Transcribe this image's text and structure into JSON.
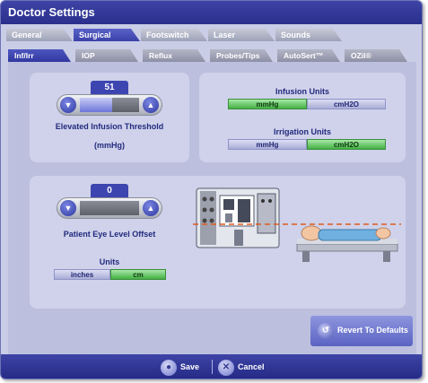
{
  "window": {
    "title": "Doctor Settings"
  },
  "main_tabs": [
    {
      "label": "General",
      "active": false
    },
    {
      "label": "Surgical",
      "active": true
    },
    {
      "label": "Footswitch",
      "active": false
    },
    {
      "label": "Laser",
      "active": false
    },
    {
      "label": "Sounds",
      "active": false
    }
  ],
  "sub_tabs": [
    {
      "label": "Inf/Irr",
      "active": true
    },
    {
      "label": "IOP",
      "active": false
    },
    {
      "label": "Reflux",
      "active": false
    },
    {
      "label": "Probes/Tips",
      "active": false
    },
    {
      "label": "AutoSert™",
      "active": false
    },
    {
      "label": "OZil®",
      "active": false
    }
  ],
  "infusion_threshold": {
    "value": "51",
    "label": "Elevated Infusion Threshold",
    "unit": "(mmHg)",
    "level_fraction": 0.55,
    "decrease_icon": "arrow-down-icon",
    "increase_icon": "arrow-up-icon"
  },
  "infusion_units": {
    "title": "Infusion Units",
    "options": [
      "mmHg",
      "cmH2O"
    ],
    "selected": "mmHg"
  },
  "irrigation_units": {
    "title": "Irrigation Units",
    "options": [
      "mmHg",
      "cmH2O"
    ],
    "selected": "cmH2O"
  },
  "eye_level": {
    "value": "0",
    "label": "Patient Eye Level Offset",
    "level_fraction": 0.0,
    "decrease_icon": "arrow-down-icon",
    "increase_icon": "arrow-up-icon"
  },
  "eye_level_units": {
    "title": "Units",
    "options": [
      "inches",
      "cm"
    ],
    "selected": "cm"
  },
  "revert_button": {
    "label": "Revert To Defaults",
    "icon": "revert-icon"
  },
  "bottom_bar": {
    "save_label": "Save",
    "cancel_label": "Cancel",
    "save_icon": "save-icon",
    "cancel_icon": "cancel-icon"
  },
  "colors": {
    "accent": "#3d45b0",
    "selected": "#43b043",
    "guide_line": "#e05a1c"
  }
}
